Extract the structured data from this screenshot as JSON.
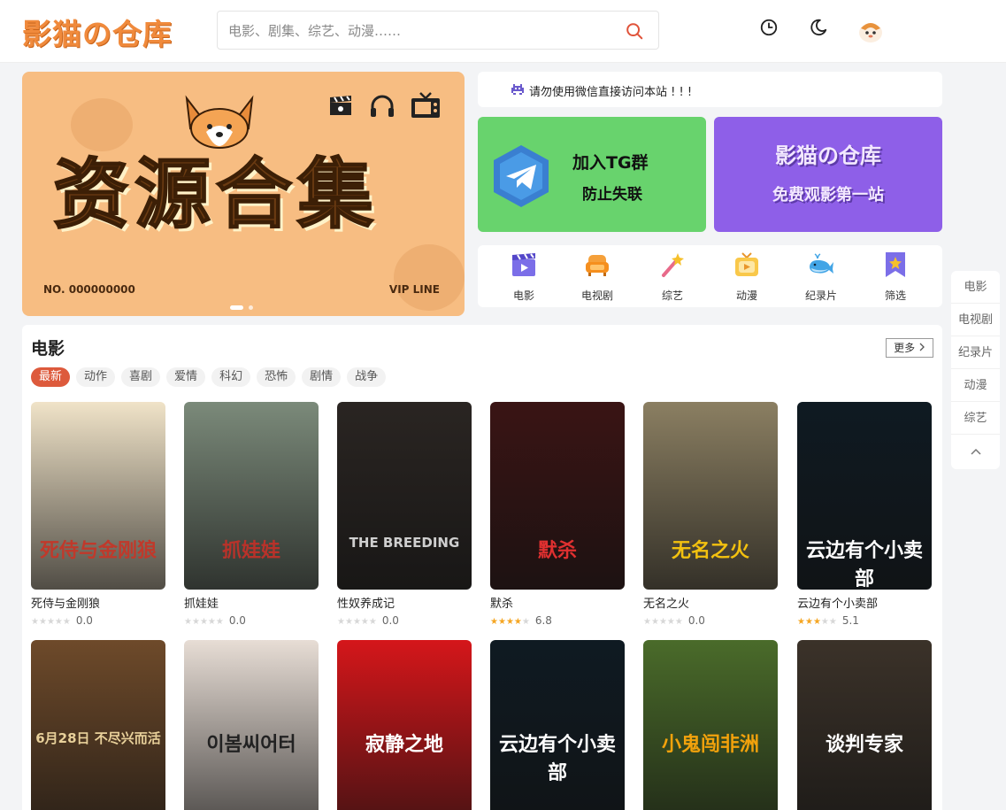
{
  "header": {
    "logo": "影猫の仓库",
    "search_placeholder": "电影、剧集、综艺、动漫……"
  },
  "banner": {
    "title": "资源合集",
    "number": "NO. 000000000",
    "vip": "VIP LINE"
  },
  "notice": "请勿使用微信直接访问本站 ! ! !",
  "promo_tg": {
    "line1": "加入TG群",
    "line2": "防止失联"
  },
  "promo_site": {
    "line1": "影猫の仓库",
    "line2": "免费观影第一站"
  },
  "categories": [
    {
      "label": "电影",
      "icon": "clapboard-icon"
    },
    {
      "label": "电视剧",
      "icon": "tv-sofa-icon"
    },
    {
      "label": "综艺",
      "icon": "magic-wand-icon"
    },
    {
      "label": "动漫",
      "icon": "anime-tv-icon"
    },
    {
      "label": "纪录片",
      "icon": "whale-icon"
    },
    {
      "label": "筛选",
      "icon": "bookmark-star-icon"
    }
  ],
  "sidenav": [
    "电影",
    "电视剧",
    "纪录片",
    "动漫",
    "综艺"
  ],
  "section": {
    "title": "电影",
    "more": "更多",
    "tags": [
      "最新",
      "动作",
      "喜剧",
      "爱情",
      "科幻",
      "恐怖",
      "剧情",
      "战争"
    ],
    "movies": [
      {
        "name": "死侍与金刚狼",
        "rating": "0.0",
        "stars": 0,
        "poster_text": "死侍与金刚狼",
        "bg": "#f0e3c8",
        "fg": "#c0392b"
      },
      {
        "name": "抓娃娃",
        "rating": "0.0",
        "stars": 0,
        "poster_text": "抓娃娃",
        "bg": "#7b8a7a",
        "fg": "#b8322a"
      },
      {
        "name": "性奴养成记",
        "rating": "0.0",
        "stars": 0,
        "poster_text": "THE BREEDING",
        "bg": "#2a2522",
        "fg": "#cfcfcf"
      },
      {
        "name": "默杀",
        "rating": "6.8",
        "stars": 3.5,
        "poster_text": "默杀",
        "bg": "#3a1414",
        "fg": "#e03030"
      },
      {
        "name": "无名之火",
        "rating": "0.0",
        "stars": 0,
        "poster_text": "无名之火",
        "bg": "#8b7f62",
        "fg": "#f3c10f"
      },
      {
        "name": "云边有个小卖部",
        "rating": "5.1",
        "stars": 2.5,
        "poster_text": "云边有个小卖部",
        "bg": "#0f1a22",
        "fg": "#ffffff"
      },
      {
        "name": "",
        "rating": "",
        "stars": 0,
        "poster_text": "6月28日 不尽兴而活",
        "bg": "#6e4a2a",
        "fg": "#e8d09a"
      },
      {
        "name": "",
        "rating": "",
        "stars": 0,
        "poster_text": "이봄씨어터",
        "bg": "#e7ddd5",
        "fg": "#222222"
      },
      {
        "name": "",
        "rating": "",
        "stars": 0,
        "poster_text": "寂静之地",
        "bg": "#d5161a",
        "fg": "#ffffff"
      },
      {
        "name": "",
        "rating": "",
        "stars": 0,
        "poster_text": "云边有个小卖部",
        "bg": "#0f1a22",
        "fg": "#ffffff"
      },
      {
        "name": "",
        "rating": "",
        "stars": 0,
        "poster_text": "小鬼闯非洲",
        "bg": "#4a6b2a",
        "fg": "#f2a20c"
      },
      {
        "name": "",
        "rating": "",
        "stars": 0,
        "poster_text": "谈判专家",
        "bg": "#3b3229",
        "fg": "#ffffff"
      }
    ]
  }
}
